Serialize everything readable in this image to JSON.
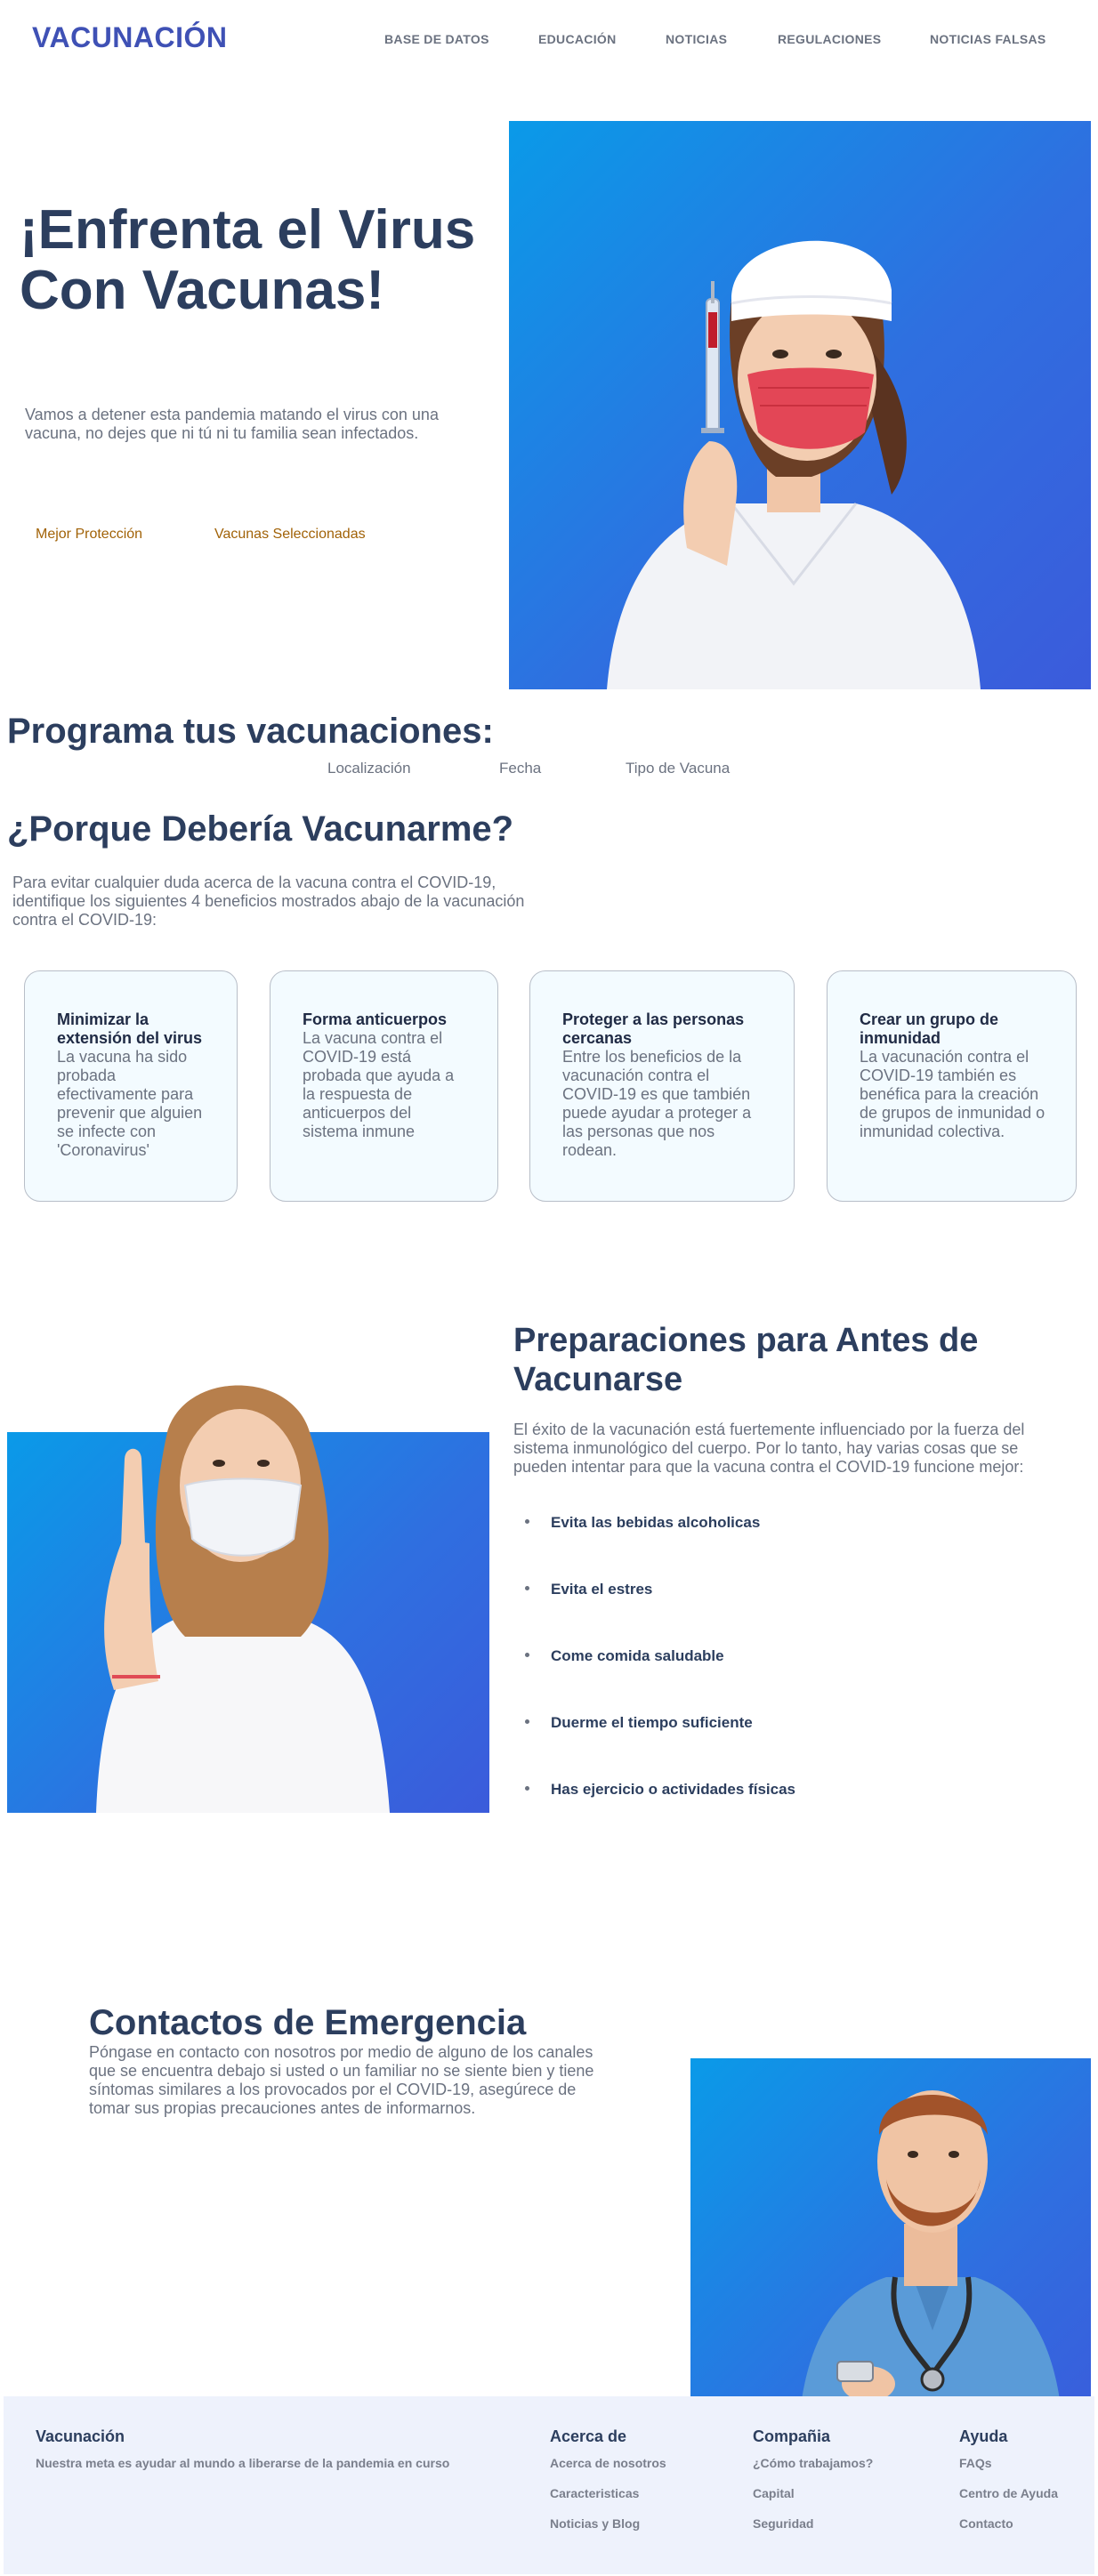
{
  "header": {
    "logo": "VACUNACIÓN",
    "nav": [
      "BASE DE DATOS",
      "EDUCACIÓN",
      "NOTICIAS",
      "REGULACIONES",
      "NOTICIAS FALSAS"
    ]
  },
  "hero": {
    "title": "¡Enfrenta el Virus Con Vacunas!",
    "subtitle": "Vamos a detener esta pandemia matando el virus con una vacuna, no dejes que ni tú ni tu familia sean infectados.",
    "links": [
      "Mejor Protección",
      "Vacunas Seleccionadas"
    ],
    "image_icon": "nurse-with-syringe-photo"
  },
  "schedule": {
    "title": "Programa tus vacunaciones:",
    "fields": [
      "Localización",
      "Fecha",
      "Tipo de Vacuna"
    ]
  },
  "why": {
    "title": "¿Porque Debería Vacunarme?",
    "intro": "Para evitar cualquier duda acerca de la vacuna contra el COVID-19, identifique los siguientes 4 beneficios mostrados abajo de la vacunación contra el COVID-19:",
    "cards": [
      {
        "title": "Minimizar la extensión del virus",
        "text": "La vacuna ha sido probada efectivamente para prevenir que alguien se infecte con 'Coronavirus'"
      },
      {
        "title": "Forma anticuerpos",
        "text": "La vacuna contra el COVID-19 está probada que ayuda a la respuesta de anticuerpos del sistema inmune"
      },
      {
        "title": "Proteger a las personas cercanas",
        "text": "Entre los beneficios de la vacunación contra el COVID-19 es que también puede ayudar a proteger a las personas que nos rodean."
      },
      {
        "title": "Crear un grupo de inmunidad",
        "text": "La vacunación contra el COVID-19 también es benéfica para la creación de grupos de inmunidad o inmunidad colectiva."
      }
    ]
  },
  "prep": {
    "title": "Preparaciones para Antes de Vacunarse",
    "intro": "El éxito de la vacunación está fuertemente influenciado por la fuerza del sistema inmunológico del cuerpo. Por lo tanto, hay varias cosas que se pueden intentar para que la vacuna contra el COVID-19 funcione mejor:",
    "items": [
      "Evita las bebidas alcoholicas",
      "Evita el estres",
      "Come comida saludable",
      "Duerme el tiempo suficiente",
      "Has ejercicio o actividades físicas"
    ],
    "image_icon": "woman-with-mask-photo"
  },
  "emergency": {
    "title": "Contactos de Emergencia",
    "text": "Póngase en contacto con nosotros por medio de alguno de los canales que se encuentra debajo si usted o un familiar no se siente bien y tiene síntomas similares a los provocados por el COVID-19, asegúrece de tomar sus propias precauciones antes de informarnos.",
    "image_icon": "doctor-with-phone-photo"
  },
  "footer": {
    "brand": "Vacunación",
    "tagline": "Nuestra meta es ayudar al mundo a liberarse de la pandemia en curso",
    "columns": [
      {
        "title": "Acerca de",
        "links": [
          "Acerca de nosotros",
          "Caracteristicas",
          "Noticias y Blog"
        ]
      },
      {
        "title": "Compañia",
        "links": [
          "¿Cómo trabajamos?",
          "Capital",
          "Seguridad"
        ]
      },
      {
        "title": "Ayuda",
        "links": [
          "FAQs",
          "Centro de Ayuda",
          "Contacto"
        ]
      }
    ]
  }
}
